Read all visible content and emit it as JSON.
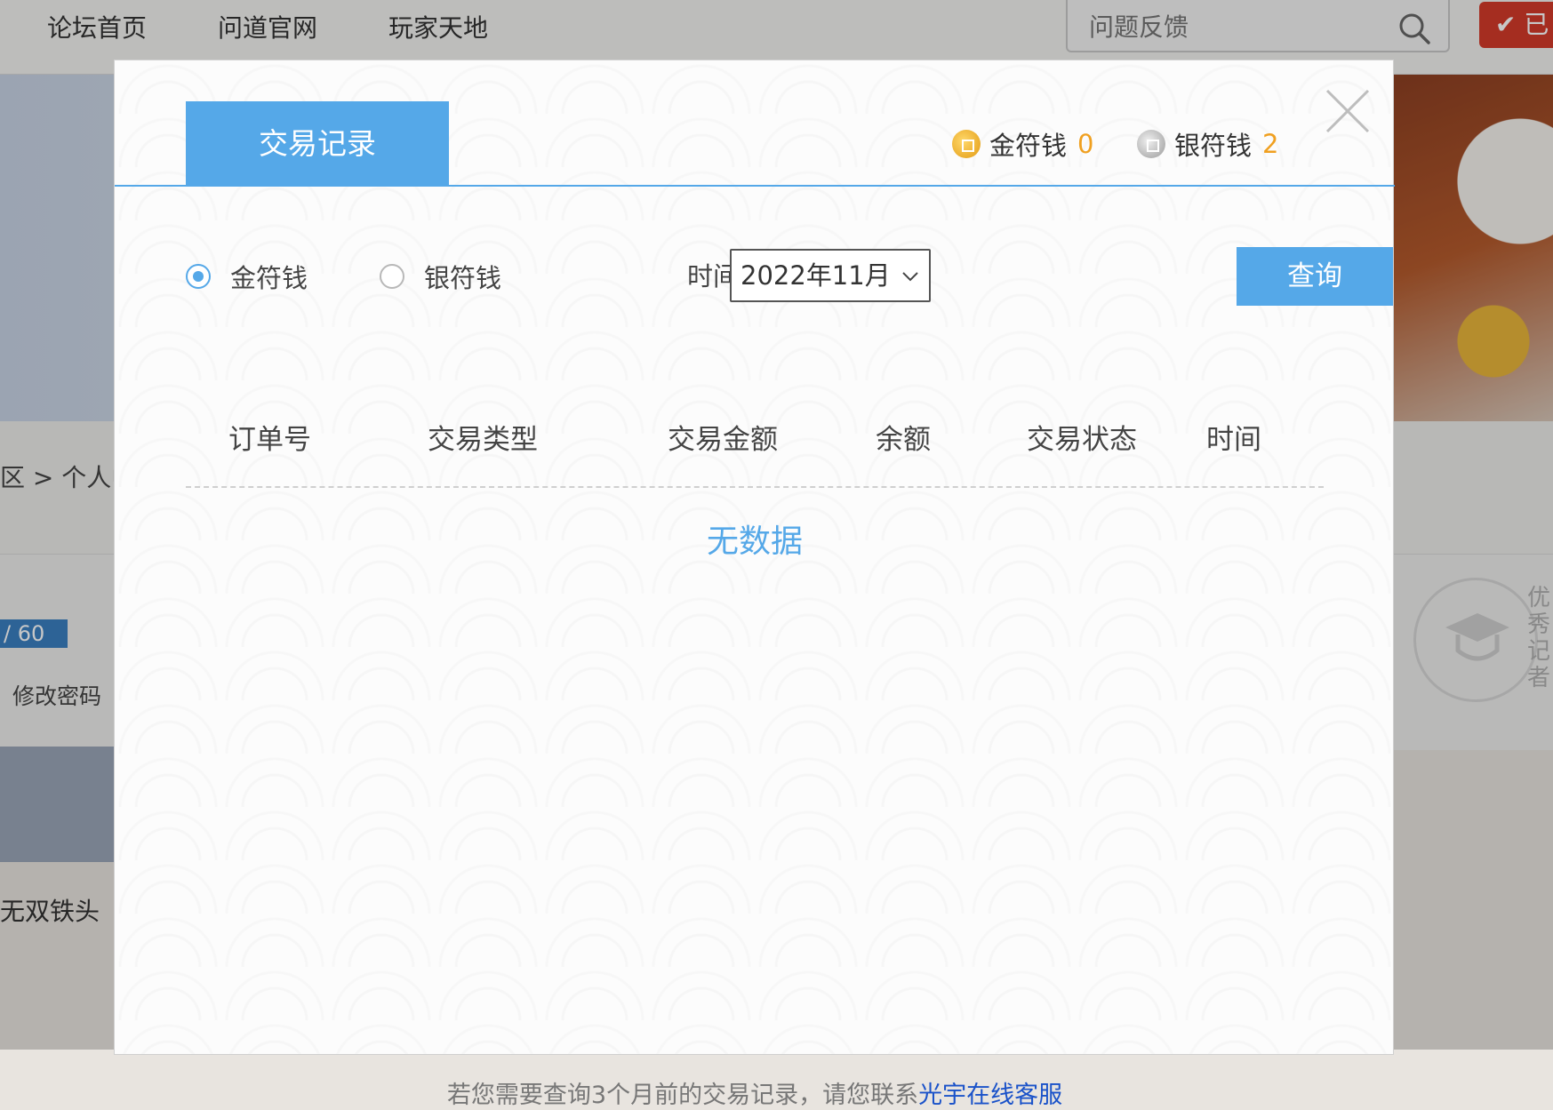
{
  "topnav": {
    "links": [
      "论坛首页",
      "问道官网",
      "玩家天地"
    ],
    "search_placeholder": "问题反馈",
    "signin_label": "已"
  },
  "background": {
    "breadcrumb": "区 > 个人中心",
    "xp_text": "/ 60",
    "change_password": "修改密码",
    "badge_text": "优秀记者",
    "user_name": "无双铁头"
  },
  "modal": {
    "tab_title": "交易记录",
    "balances": [
      {
        "label": "金符钱",
        "value": "0",
        "icon": "gold-coin-icon"
      },
      {
        "label": "银符钱",
        "value": "2",
        "icon": "silver-coin-icon"
      }
    ],
    "filter": {
      "options": [
        "金符钱",
        "银符钱"
      ],
      "selected": "金符钱",
      "time_label": "时间 ：",
      "month": "2022年11月",
      "query_label": "查询"
    },
    "table": {
      "columns": [
        "订单号",
        "交易类型",
        "交易金额",
        "余额",
        "交易状态",
        "时间"
      ],
      "rows": [],
      "empty_text": "无数据"
    },
    "footer": {
      "note": "若您需要查询3个月前的交易记录，请您联系",
      "link": "光宇在线客服"
    }
  },
  "colors": {
    "accent": "#55a8e8",
    "coin_value": "#f0a020",
    "link": "#1a52c9"
  }
}
